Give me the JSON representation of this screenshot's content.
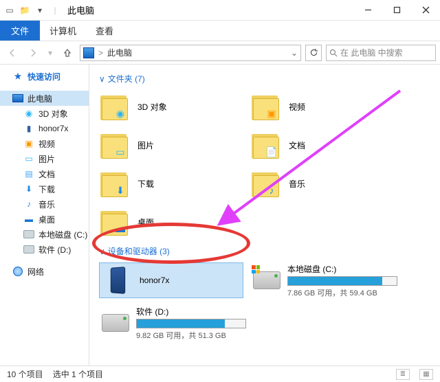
{
  "window": {
    "title": "此电脑"
  },
  "menubar": {
    "file": "文件",
    "computer": "计算机",
    "view": "查看"
  },
  "nav": {
    "path": "此电脑",
    "path_sep": ">",
    "search_placeholder": "在 此电脑 中搜索"
  },
  "sidebar": {
    "quick_access": "快速访问",
    "this_pc": "此电脑",
    "items": [
      {
        "label": "3D 对象"
      },
      {
        "label": "honor7x"
      },
      {
        "label": "视频"
      },
      {
        "label": "图片"
      },
      {
        "label": "文档"
      },
      {
        "label": "下载"
      },
      {
        "label": "音乐"
      },
      {
        "label": "桌面"
      },
      {
        "label": "本地磁盘 (C:)"
      },
      {
        "label": "软件 (D:)"
      }
    ],
    "network": "网络"
  },
  "sections": {
    "folders": {
      "header": "文件夹 (7)",
      "chev": "∨"
    },
    "devices": {
      "header": "设备和驱动器 (3)",
      "chev": "∨"
    }
  },
  "folders": [
    {
      "label": "3D 对象",
      "overlay_color": "#29b6f6",
      "overlay_glyph": "◉"
    },
    {
      "label": "视频",
      "overlay_color": "#ff9800",
      "overlay_glyph": "▣"
    },
    {
      "label": "图片",
      "overlay_color": "#29b6f6",
      "overlay_glyph": "▭"
    },
    {
      "label": "文档",
      "overlay_color": "#42a5f5",
      "overlay_glyph": "📄"
    },
    {
      "label": "下载",
      "overlay_color": "#1e88e5",
      "overlay_glyph": "⬇"
    },
    {
      "label": "音乐",
      "overlay_color": "#1e88e5",
      "overlay_glyph": "♪"
    },
    {
      "label": "桌面",
      "overlay_color": "#1976d2",
      "overlay_glyph": "▬"
    }
  ],
  "drives": [
    {
      "name": "honor7x",
      "kind": "phone",
      "selected": true
    },
    {
      "name": "本地磁盘 (C:)",
      "kind": "hdd-win",
      "free_line": "7.86 GB 可用，共 59.4 GB",
      "used_pct": 87
    },
    {
      "name": "软件 (D:)",
      "kind": "hdd",
      "free_line": "9.82 GB 可用，共 51.3 GB",
      "used_pct": 81
    }
  ],
  "status": {
    "total": "10 个项目",
    "selected": "选中 1 个项目"
  },
  "annotation": {
    "arrow_color": "#e040fb",
    "ellipse_color": "#e53935"
  }
}
